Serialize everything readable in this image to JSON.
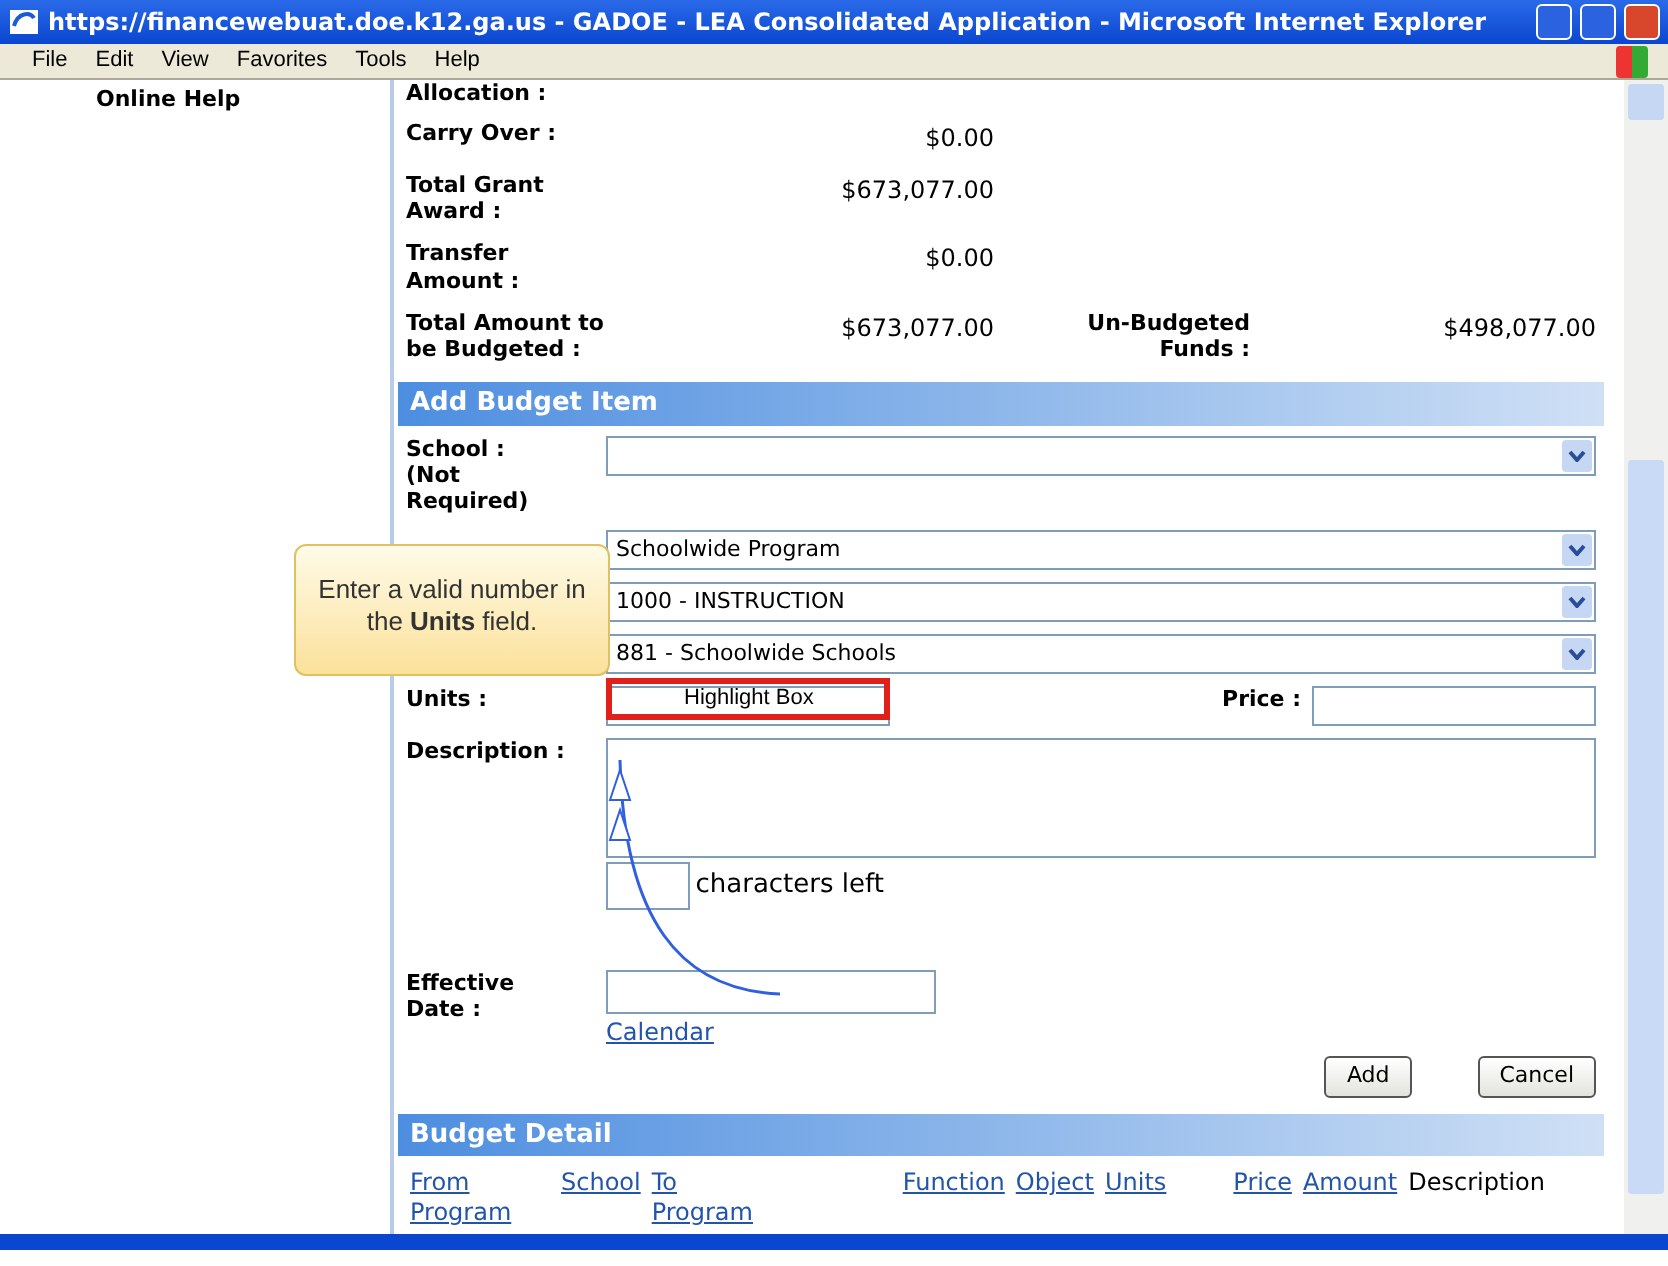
{
  "window": {
    "title": "https://financewebuat.doe.k12.ga.us - GADOE - LEA Consolidated Application - Microsoft Internet Explorer"
  },
  "menu": [
    "File",
    "Edit",
    "View",
    "Favorites",
    "Tools",
    "Help"
  ],
  "sidebar": {
    "link": "Online Help"
  },
  "summary": [
    {
      "label": "Allocation :"
    },
    {
      "label": "Carry Over :",
      "value": "$0.00"
    },
    {
      "label": "Total Grant Award :",
      "value": "$673,077.00"
    },
    {
      "label": "Transfer Amount :",
      "value": "$0.00"
    },
    {
      "label": "Total Amount to be Budgeted :",
      "value": "$673,077.00",
      "label_2": "Un-Budgeted Funds :",
      "value_2": "$498,077.00"
    }
  ],
  "add_section": {
    "title": "Add Budget Item",
    "school": {
      "label": "School : (Not Required)"
    },
    "selects": [
      "Schoolwide Program",
      "1000 - INSTRUCTION",
      "881 - Schoolwide Schools"
    ],
    "units": {
      "label": "Units :"
    },
    "price": {
      "label": "Price :"
    },
    "description": {
      "label": "Description :"
    },
    "chars_left": {
      "suffix": "characters left"
    },
    "effective_date": {
      "label": "Effective Date :",
      "link": "Calendar"
    },
    "buttons": [
      "Add",
      "Cancel"
    ]
  },
  "detail_section": {
    "title": "Budget Detail",
    "columns": [
      {
        "text": "From Program",
        "kind": "link"
      },
      {
        "text": "School",
        "kind": "link"
      },
      {
        "text": "To Program",
        "kind": "link"
      },
      {
        "text": "Function",
        "kind": "link"
      },
      {
        "text": "Object",
        "kind": "link"
      },
      {
        "text": "Units",
        "kind": "link"
      },
      {
        "text": "Price",
        "kind": "link"
      },
      {
        "text": "Amount",
        "kind": "link"
      },
      {
        "text": "Description",
        "kind": "plain"
      }
    ]
  },
  "callout": {
    "text": "Enter a valid number in the **Units** field.",
    "highlight_label": "Highlight Box"
  }
}
